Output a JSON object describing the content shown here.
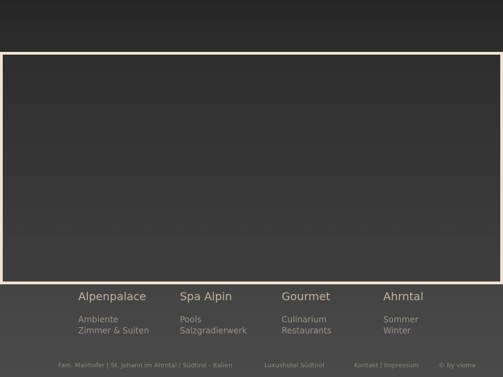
{
  "nav": [
    {
      "heading": "Alpenpalace",
      "links": [
        "Ambiente",
        "Zimmer & Suiten"
      ]
    },
    {
      "heading": "Spa Alpin",
      "links": [
        "Pools",
        "Salzgradierwerk"
      ]
    },
    {
      "heading": "Gourmet",
      "links": [
        "Culinarium",
        "Restaurants"
      ]
    },
    {
      "heading": "Ahrntal",
      "links": [
        "Sommer",
        "Winter"
      ]
    }
  ],
  "footer": {
    "address": "Fam. Mairhofer | St. Johann im Ahrntal / Südtirol - Italien",
    "tagline": "Luxushotel Südtirol",
    "kontakt": "Kontakt",
    "separator": "|",
    "impressum": "Impressum",
    "credit": "© by vioma"
  },
  "colors": {
    "frame_border": "#ede4d2",
    "heading": "#bdb29d",
    "link": "#999188"
  }
}
